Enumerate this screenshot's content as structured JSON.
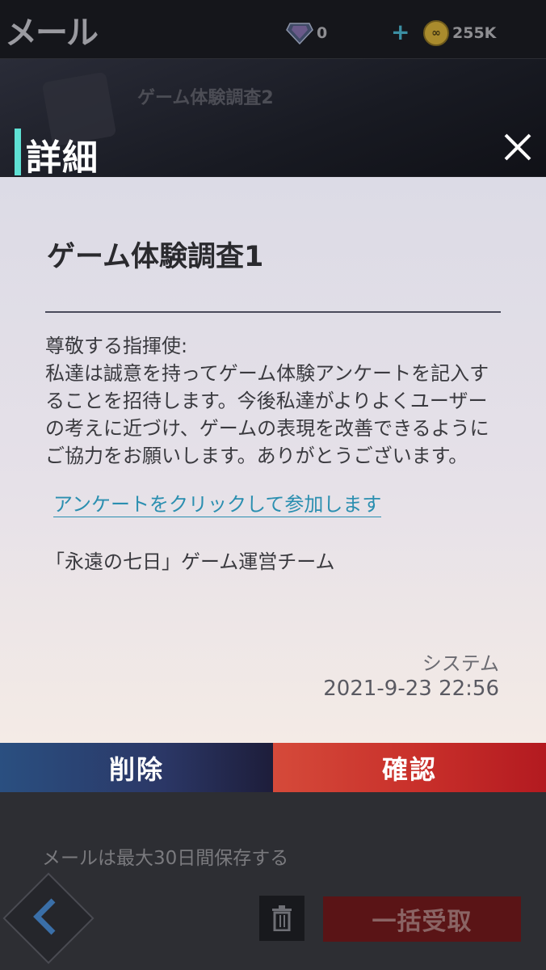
{
  "background": {
    "screen_title": "メール",
    "gems": "0",
    "plus": "+",
    "coins": "255K",
    "list_item_title": "ゲーム体験調査2",
    "keep_note": "メールは最大30日間保存する",
    "claim_all_label": "一括受取"
  },
  "modal": {
    "header_title": "詳細",
    "mail_title": "ゲーム体験調査1",
    "greeting": "尊敬する指揮使:",
    "body": " 私達は誠意を持ってゲーム体験アンケートを記入することを招待します。今後私達がよりよくユーザーの考えに近づけ、ゲームの表現を改善できるようにご協力をお願いします。ありがとうございます。",
    "survey_link": "アンケートをクリックして参加します",
    "signature": "「永遠の七日」ゲーム運営チーム",
    "sender": "システム",
    "datetime": "2021-9-23 22:56",
    "delete_label": "削除",
    "confirm_label": "確認"
  },
  "colors": {
    "accent": "#5ee0d3",
    "delete_button": "#2b3766",
    "confirm_button": "#c82f2a",
    "link": "#2b8fb0"
  },
  "icons": [
    "gem-icon",
    "coin-icon",
    "close-icon",
    "back-chevron-icon",
    "trash-icon"
  ]
}
